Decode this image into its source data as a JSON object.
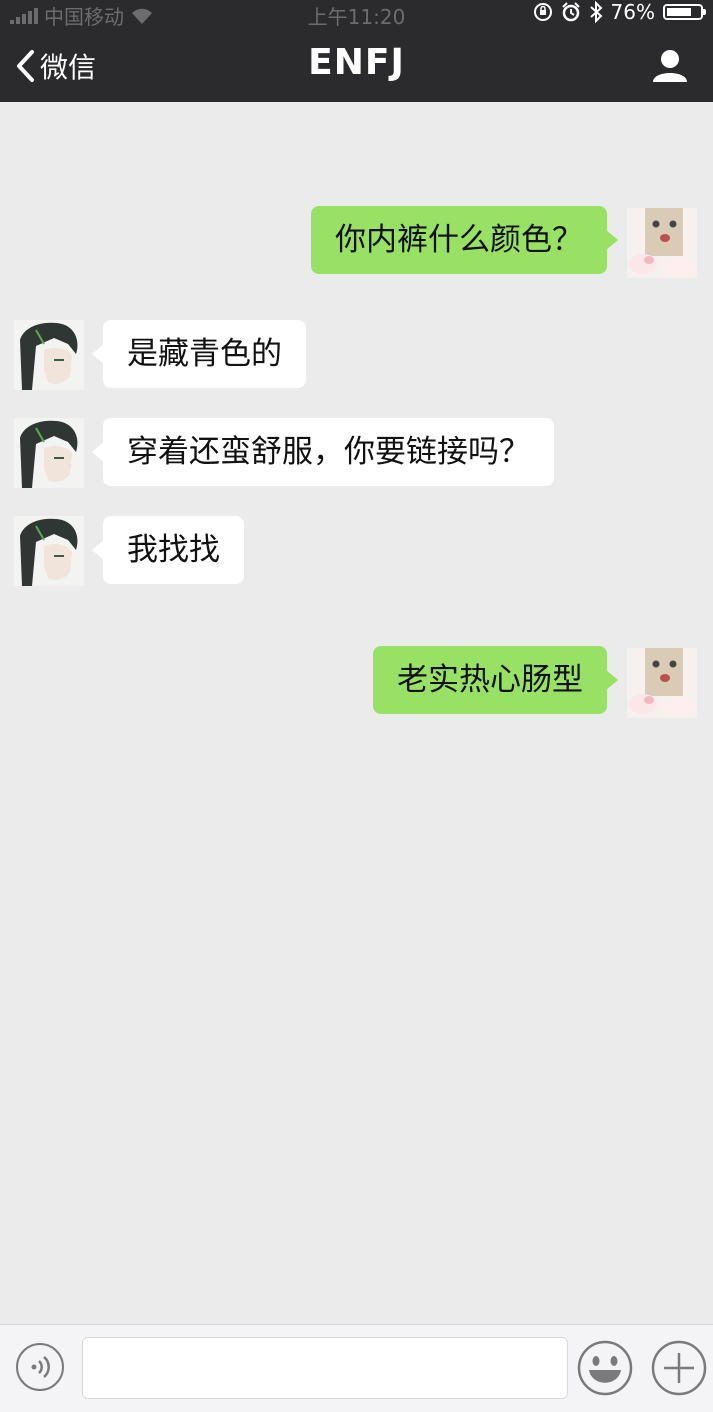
{
  "status_bar": {
    "carrier": "中国移动",
    "time": "上午11:20",
    "battery": "76%",
    "battery_level": 0.76
  },
  "nav": {
    "back_label": "微信",
    "title": "ENFJ"
  },
  "messages": [
    {
      "side": "sent",
      "text": "你内裤什么颜色？"
    },
    {
      "side": "received",
      "text": "是藏青色的"
    },
    {
      "side": "received",
      "text": "穿着还蛮舒服，你要链接吗？"
    },
    {
      "side": "received",
      "text": "我找找"
    },
    {
      "side": "sent",
      "text": "老实热心肠型"
    }
  ],
  "input_bar": {
    "icons": [
      "voice-icon",
      "emoji-icon",
      "plus-icon"
    ]
  },
  "colors": {
    "nav_bg": "#2b2b2d",
    "chat_bg": "#ebebeb",
    "sent_bubble": "#98e165",
    "received_bubble": "#ffffff"
  }
}
